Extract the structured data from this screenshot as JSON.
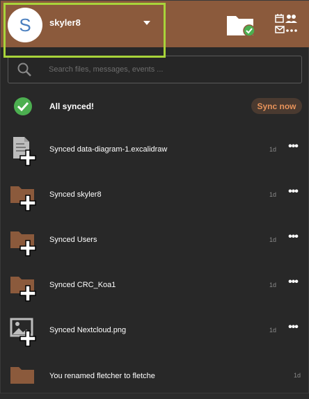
{
  "account": {
    "avatar_letter": "S",
    "name": "skyler8"
  },
  "search": {
    "placeholder": "Search files, messages, events ..."
  },
  "sync": {
    "status": "All synced!",
    "button_label": "Sync now"
  },
  "activities": [
    {
      "icon": "document-add-icon",
      "text": "Synced data-diagram-1.excalidraw",
      "time": "1d",
      "more": "•••"
    },
    {
      "icon": "folder-add-icon",
      "text": "Synced skyler8",
      "time": "1d",
      "more": "•••"
    },
    {
      "icon": "folder-add-icon",
      "text": "Synced Users",
      "time": "1d",
      "more": "•••"
    },
    {
      "icon": "folder-add-icon",
      "text": "Synced CRC_Koa1",
      "time": "1d",
      "more": "•••"
    },
    {
      "icon": "image-add-icon",
      "text": "Synced Nextcloud.png",
      "time": "1d",
      "more": "•••"
    },
    {
      "icon": "folder-icon",
      "text": "You renamed fletcher to fletche",
      "time": "1d"
    }
  ],
  "colors": {
    "header": "#8b5a3c",
    "folder": "#8b5a3c",
    "accent_green": "#4caf50",
    "highlight": "#a8d43a",
    "sync_button_text": "#e8935a"
  }
}
